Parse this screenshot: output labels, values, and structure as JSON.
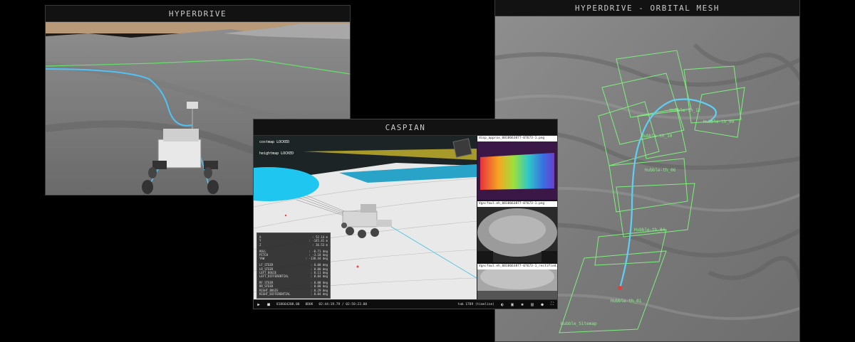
{
  "windows": {
    "hyperdrive": {
      "title": "HYPERDRIVE"
    },
    "orbital": {
      "title": "HYPERDRIVE - ORBITAL MESH",
      "labels": [
        "Hubble-th_09",
        "Hubble-th_12",
        "Hubble-th_10",
        "Hubble-th_06",
        "Hubble-th_04",
        "Hubble-th_01",
        "Hubble_Sitemap"
      ]
    },
    "caspian": {
      "title": "CASPIAN",
      "locks": [
        "costmap LOCKED",
        "heightmap LOCKED"
      ],
      "hud": {
        "rows1": [
          [
            "X",
            ": 52.14 m"
          ],
          [
            "Y",
            ": -145.41 m"
          ],
          [
            "Z",
            ": 36.53 m"
          ]
        ],
        "rows2": [
          [
            "ROLL",
            ": -0.71 deg"
          ],
          [
            "PITCH",
            ": -3.18 deg"
          ],
          [
            "YAW",
            ": -130.44 deg"
          ]
        ],
        "rows3": [
          [
            "LF_STEER",
            ": 0.00 deg"
          ],
          [
            "LR_STEER",
            ": 0.00 deg"
          ],
          [
            "LEFT_BOGIE",
            ": 0.11 deg"
          ],
          [
            "LEFT_DIFFERENTIAL",
            ": 0.04 deg"
          ]
        ],
        "rows4": [
          [
            "RF_STEER",
            ": 0.00 deg"
          ],
          [
            "RR_STEER",
            ": 0.00 deg"
          ],
          [
            "RIGHT_BOGIE",
            ": 0.29 deg"
          ],
          [
            "RIGHT_DIFFERENTIAL",
            ": 0.04 deg"
          ]
        ]
      },
      "thumbs": [
        "disp_approx_0818663877-07673-1.png",
        "Vgncfowl.eh_0818663877-07673-1.png",
        "Vgncfowl.eh_0818663877-07673-1_rectified.png"
      ],
      "player": {
        "frame": "818664208.00",
        "speed": "8DUK",
        "time": "02:44:19.79 / 02:58:23.00",
        "status": "tab 1789 (timeline)"
      }
    }
  }
}
